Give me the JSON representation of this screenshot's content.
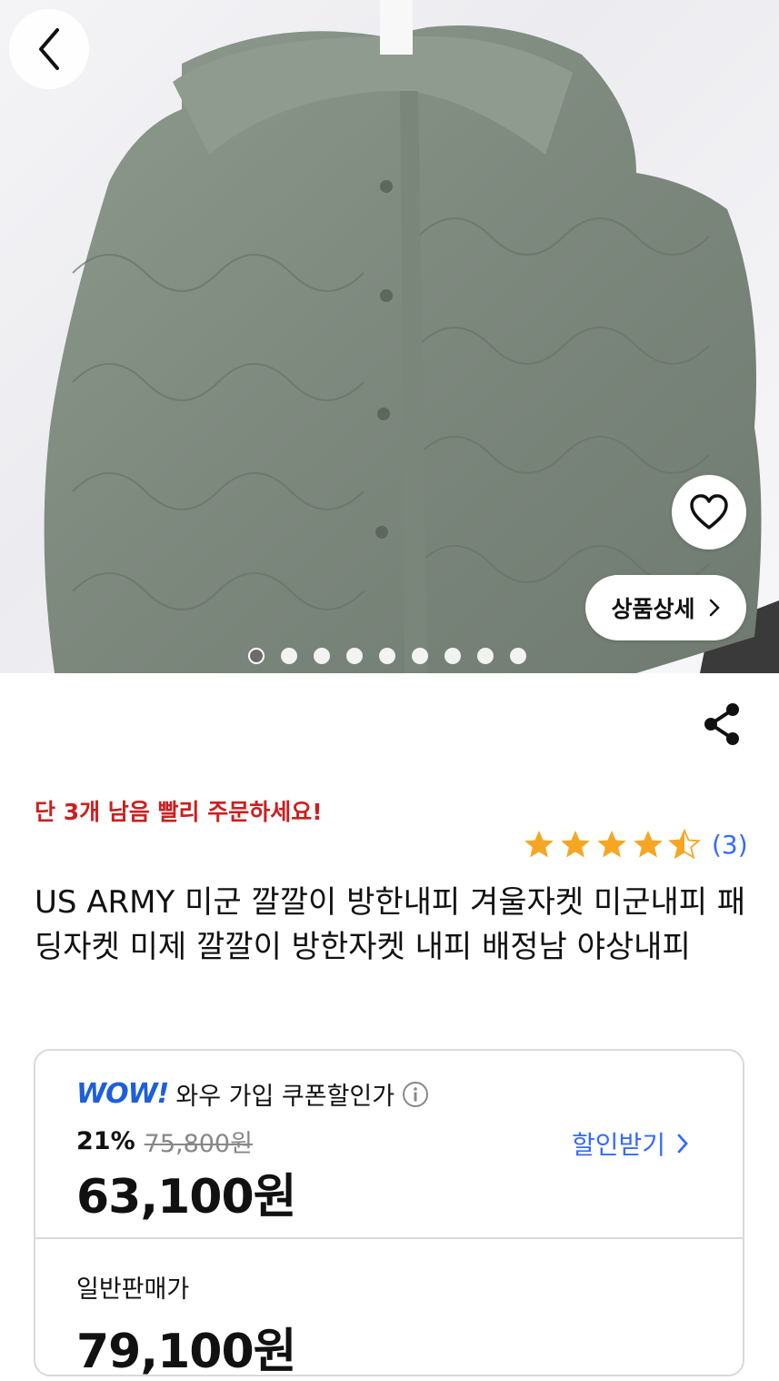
{
  "hero": {
    "image_icon": "quilted-jacket-photo",
    "carousel_total": 9,
    "carousel_active": 1,
    "back_icon": "chevron-left-icon",
    "favorite_icon": "heart-icon",
    "detail_button_label": "상품상세",
    "detail_chevron_icon": "chevron-right-icon"
  },
  "share_icon": "share-icon",
  "stock_notice": "단 3개 남음 빨리 주문하세요!",
  "rating": {
    "stars": 4.5,
    "max": 5,
    "count_text": "(3)",
    "star_color": "#f5a623"
  },
  "product_title": "US ARMY 미군 깔깔이 방한내피 겨울자켓 미군내피 패딩자켓 미제 깔깔이 방한자켓 내피 배정남 야상내피",
  "price": {
    "wow_logo": "WOW!",
    "wow_label": "와우 가입 쿠폰할인가",
    "info_icon": "info-icon",
    "discount_pct": "21%",
    "original_price": "75,800원",
    "coupon_price": "63,100원",
    "get_discount_label": "할인받기",
    "normal_label": "일반판매가",
    "normal_price": "79,100원",
    "accent_color": "#346aff",
    "urgent_color": "#cc1f1f"
  }
}
